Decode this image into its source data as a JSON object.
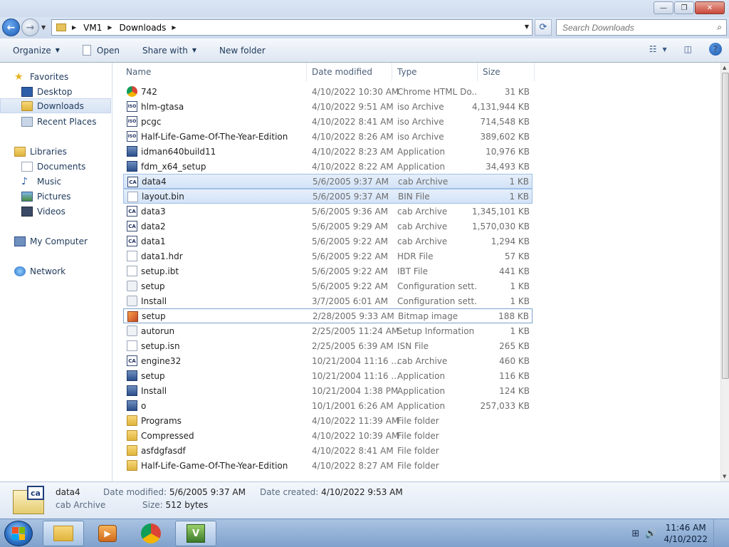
{
  "window": {
    "controls": {
      "minimize": "—",
      "maximize": "❐",
      "close": "✕"
    }
  },
  "address": {
    "crumbs": [
      "VM1",
      "Downloads"
    ],
    "search_placeholder": "Search Downloads"
  },
  "toolbar": {
    "organize": "Organize",
    "open": "Open",
    "share_with": "Share with",
    "new_folder": "New folder"
  },
  "nav": {
    "favorites": "Favorites",
    "desktop": "Desktop",
    "downloads": "Downloads",
    "recent_places": "Recent Places",
    "libraries": "Libraries",
    "documents": "Documents",
    "music": "Music",
    "pictures": "Pictures",
    "videos": "Videos",
    "my_computer": "My Computer",
    "network": "Network"
  },
  "columns": {
    "name": "Name",
    "date_modified": "Date modified",
    "type": "Type",
    "size": "Size"
  },
  "files": [
    {
      "name": "742",
      "date": "4/10/2022 10:30 AM",
      "type": "Chrome HTML Do...",
      "size": "31 KB",
      "icon": "chrome"
    },
    {
      "name": "hlm-gtasa",
      "date": "4/10/2022 9:51 AM",
      "type": "iso Archive",
      "size": "4,131,944 KB",
      "icon": "iso"
    },
    {
      "name": "pcgc",
      "date": "4/10/2022 8:41 AM",
      "type": "iso Archive",
      "size": "714,548 KB",
      "icon": "iso"
    },
    {
      "name": "Half-Life-Game-Of-The-Year-Edition",
      "date": "4/10/2022 8:26 AM",
      "type": "iso Archive",
      "size": "389,602 KB",
      "icon": "iso"
    },
    {
      "name": "idman640build11",
      "date": "4/10/2022 8:23 AM",
      "type": "Application",
      "size": "10,976 KB",
      "icon": "app"
    },
    {
      "name": "fdm_x64_setup",
      "date": "4/10/2022 8:22 AM",
      "type": "Application",
      "size": "34,493 KB",
      "icon": "app"
    },
    {
      "name": "data4",
      "date": "5/6/2005 9:37 AM",
      "type": "cab Archive",
      "size": "1 KB",
      "icon": "cab"
    },
    {
      "name": "layout.bin",
      "date": "5/6/2005 9:37 AM",
      "type": "BIN File",
      "size": "1 KB",
      "icon": "doc"
    },
    {
      "name": "data3",
      "date": "5/6/2005 9:36 AM",
      "type": "cab Archive",
      "size": "1,345,101 KB",
      "icon": "cab"
    },
    {
      "name": "data2",
      "date": "5/6/2005 9:29 AM",
      "type": "cab Archive",
      "size": "1,570,030 KB",
      "icon": "cab"
    },
    {
      "name": "data1",
      "date": "5/6/2005 9:22 AM",
      "type": "cab Archive",
      "size": "1,294 KB",
      "icon": "cab"
    },
    {
      "name": "data1.hdr",
      "date": "5/6/2005 9:22 AM",
      "type": "HDR File",
      "size": "57 KB",
      "icon": "doc"
    },
    {
      "name": "setup.ibt",
      "date": "5/6/2005 9:22 AM",
      "type": "IBT File",
      "size": "441 KB",
      "icon": "doc"
    },
    {
      "name": "setup",
      "date": "5/6/2005 9:22 AM",
      "type": "Configuration sett...",
      "size": "1 KB",
      "icon": "cfg"
    },
    {
      "name": "Install",
      "date": "3/7/2005 6:01 AM",
      "type": "Configuration sett...",
      "size": "1 KB",
      "icon": "cfg"
    },
    {
      "name": "setup",
      "date": "2/28/2005 9:33 AM",
      "type": "Bitmap image",
      "size": "188 KB",
      "icon": "bmp"
    },
    {
      "name": "autorun",
      "date": "2/25/2005 11:24 AM",
      "type": "Setup Information",
      "size": "1 KB",
      "icon": "cfg"
    },
    {
      "name": "setup.isn",
      "date": "2/25/2005 6:39 AM",
      "type": "ISN File",
      "size": "265 KB",
      "icon": "doc"
    },
    {
      "name": "engine32",
      "date": "10/21/2004 11:16 ...",
      "type": "cab Archive",
      "size": "460 KB",
      "icon": "cab"
    },
    {
      "name": "setup",
      "date": "10/21/2004 11:16 ...",
      "type": "Application",
      "size": "116 KB",
      "icon": "app"
    },
    {
      "name": "Install",
      "date": "10/21/2004 1:38 PM",
      "type": "Application",
      "size": "124 KB",
      "icon": "app"
    },
    {
      "name": "o",
      "date": "10/1/2001 6:26 AM",
      "type": "Application",
      "size": "257,033 KB",
      "icon": "app"
    },
    {
      "name": "Programs",
      "date": "4/10/2022 11:39 AM",
      "type": "File folder",
      "size": "",
      "icon": "folder"
    },
    {
      "name": "Compressed",
      "date": "4/10/2022 10:39 AM",
      "type": "File folder",
      "size": "",
      "icon": "folder"
    },
    {
      "name": "asfdgfasdf",
      "date": "4/10/2022 8:41 AM",
      "type": "File folder",
      "size": "",
      "icon": "folder"
    },
    {
      "name": "Half-Life-Game-Of-The-Year-Edition",
      "date": "4/10/2022 8:27 AM",
      "type": "File folder",
      "size": "",
      "icon": "folder"
    }
  ],
  "selection": {
    "selected_rows": [
      6,
      7
    ],
    "focused_row": 15
  },
  "details": {
    "name": "data4",
    "type": "cab Archive",
    "date_modified_label": "Date modified:",
    "date_modified": "5/6/2005 9:37 AM",
    "date_created_label": "Date created:",
    "date_created": "4/10/2022 9:53 AM",
    "size_label": "Size:",
    "size": "512 bytes",
    "icon_label": "ca"
  },
  "taskbar": {
    "time": "11:46 AM",
    "date": "4/10/2022"
  }
}
